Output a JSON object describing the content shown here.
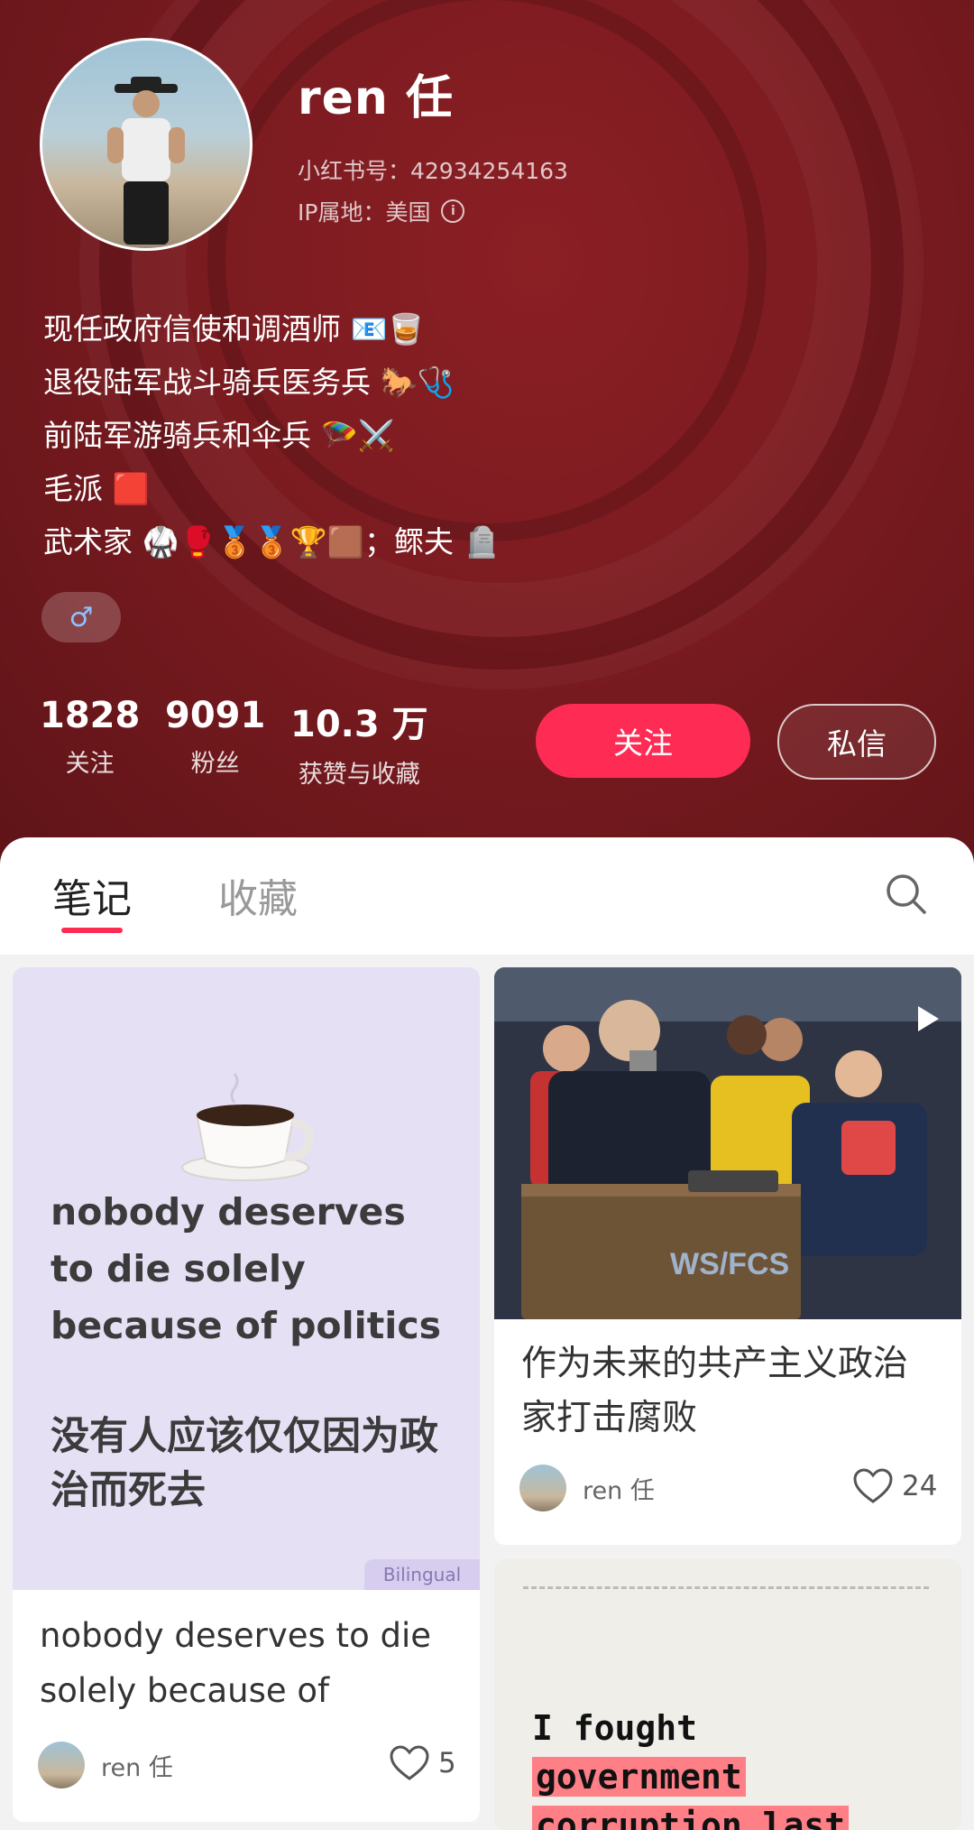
{
  "profile": {
    "username": "ren 任",
    "id_label": "小红书号：42934254163",
    "ip_label": "IP属地：美国",
    "bio": [
      "现任政府信使和调酒师 📧🥃",
      "退役陆军战斗骑兵医务兵 🐎🩺",
      "前陆军游骑兵和伞兵 🪂⚔️",
      "毛派 🟥",
      "武术家 🥋🥊🥉🥉🏆🟫；鳏夫 🪦"
    ],
    "gender_symbol": "♂",
    "stats": [
      {
        "value": "1828",
        "label": "关注"
      },
      {
        "value": "9091",
        "label": "粉丝"
      },
      {
        "value": "10.3 万",
        "label": "获赞与收藏"
      }
    ],
    "follow_label": "关注",
    "message_label": "私信"
  },
  "tabs": {
    "notes": "笔记",
    "collections": "收藏"
  },
  "notes": [
    {
      "cover_text_en": "nobody deserves to die solely because of politics",
      "cover_text_zh": "没有人应该仅仅因为政治而死去",
      "tag": "Bilingual",
      "title": "nobody deserves to die solely because of",
      "author": "ren 任",
      "likes": "5"
    },
    {
      "cover_podium_text": "WS/FCS",
      "title": "作为未来的共产主义政治家打击腐败",
      "author": "ren 任",
      "likes": "24"
    },
    {
      "cover_line1": "I fought",
      "cover_line2": "government",
      "cover_line3": "corruption last"
    }
  ],
  "colors": {
    "accent": "#fe2c55",
    "header_bg": "#7a1b20"
  }
}
